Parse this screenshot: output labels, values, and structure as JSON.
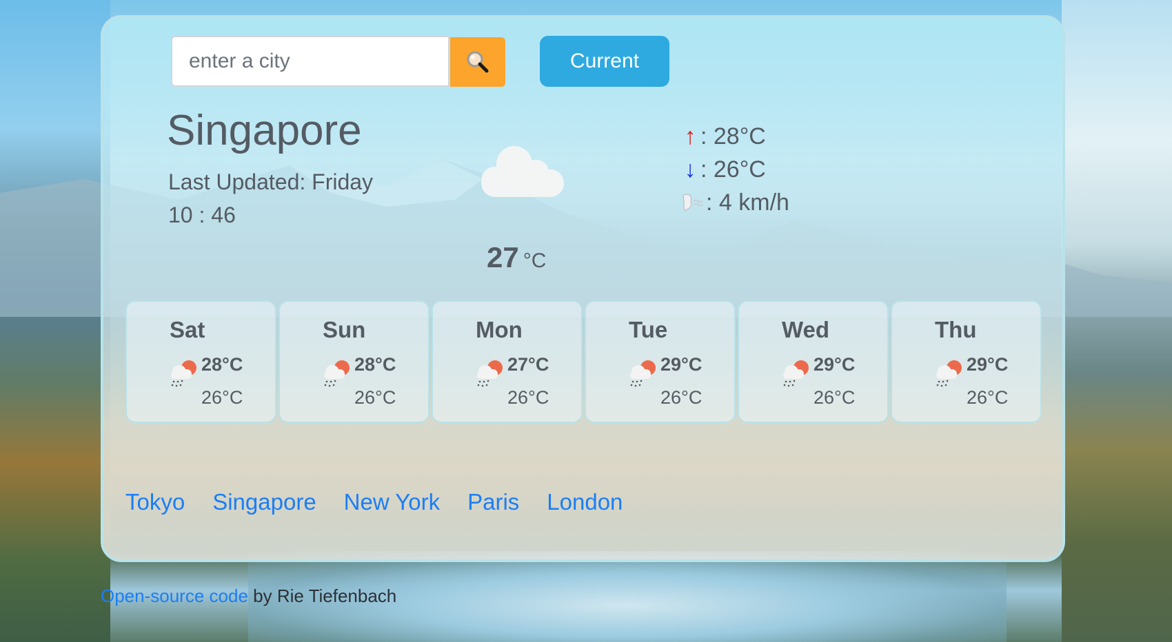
{
  "search": {
    "placeholder": "enter a city",
    "value": "",
    "button_icon": "magnifying-glass-icon"
  },
  "current_button": {
    "label": "Current"
  },
  "weather": {
    "city": "Singapore",
    "last_updated_label": "Last Updated: Friday",
    "time": "10 : 46",
    "icon": "cloud-icon",
    "temperature": "27",
    "unit": "°C",
    "high": ": 28°C",
    "low": ": 26°C",
    "wind": ": 4 km/h",
    "high_icon": "↑",
    "low_icon": "↓",
    "wind_icon": "wind-face-icon"
  },
  "forecast": [
    {
      "day": "Sat",
      "high": "28°C",
      "low": "26°C",
      "icon": "sun-behind-rain-cloud-icon"
    },
    {
      "day": "Sun",
      "high": "28°C",
      "low": "26°C",
      "icon": "sun-behind-rain-cloud-icon"
    },
    {
      "day": "Mon",
      "high": "27°C",
      "low": "26°C",
      "icon": "sun-behind-rain-cloud-icon"
    },
    {
      "day": "Tue",
      "high": "29°C",
      "low": "26°C",
      "icon": "sun-behind-rain-cloud-icon"
    },
    {
      "day": "Wed",
      "high": "29°C",
      "low": "26°C",
      "icon": "sun-behind-rain-cloud-icon"
    },
    {
      "day": "Thu",
      "high": "29°C",
      "low": "26°C",
      "icon": "sun-behind-rain-cloud-icon"
    }
  ],
  "city_links": [
    "Tokyo",
    "Singapore",
    "New York",
    "Paris",
    "London"
  ],
  "footer": {
    "link_text": "Open-source code",
    "text": " by Rie Tiefenbach"
  },
  "colors": {
    "search_button": "#fca42c",
    "current_button": "#2eaae0",
    "link": "#1b7ef5",
    "text": "#545b63",
    "arrow_up": "#e41b1b",
    "arrow_down": "#1a2fe0"
  }
}
